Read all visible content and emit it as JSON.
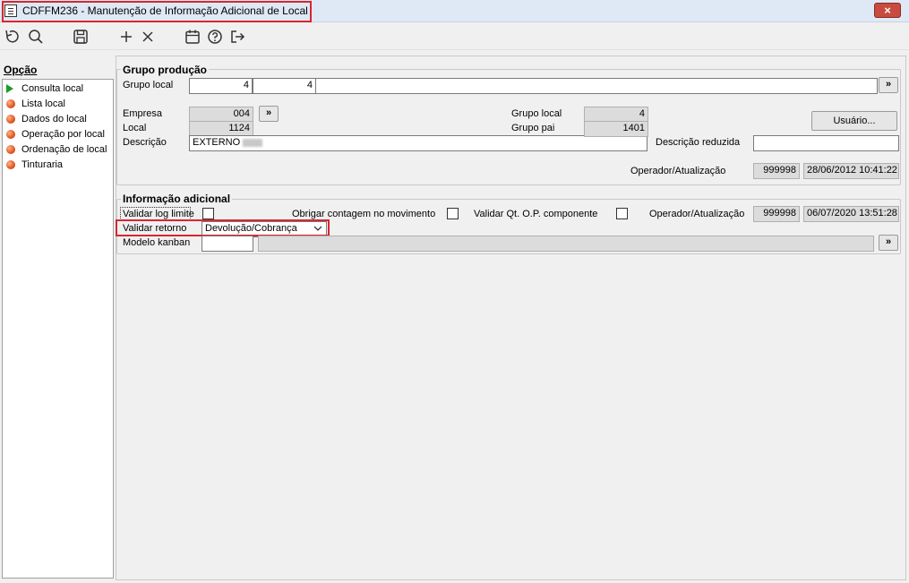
{
  "window": {
    "title": "CDFFM236 - Manutenção de Informação Adicional de Local",
    "close_glyph": "×"
  },
  "toolbar": {
    "icons": [
      "refresh-icon",
      "search-icon",
      "save-icon",
      "add-icon",
      "cancel-icon",
      "calendar-icon",
      "help-icon",
      "exit-icon"
    ]
  },
  "sidebar": {
    "heading": "Opção",
    "items": [
      {
        "label": "Consulta local",
        "icon": "play-icon"
      },
      {
        "label": "Lista local",
        "icon": "bullet-icon"
      },
      {
        "label": "Dados do local",
        "icon": "bullet-icon"
      },
      {
        "label": "Operação por local",
        "icon": "bullet-icon"
      },
      {
        "label": "Ordenação de local",
        "icon": "bullet-icon"
      },
      {
        "label": "Tinturaria",
        "icon": "bullet-icon"
      }
    ]
  },
  "grupo_producao": {
    "title": "Grupo produção",
    "grupo_local_label": "Grupo local",
    "grupo_local_value1": "4",
    "grupo_local_value2": "4",
    "lookup_glyph": "»",
    "empresa_label": "Empresa",
    "empresa_value": "004",
    "local_label": "Local",
    "local_value": "1124",
    "descricao_label": "Descrição",
    "descricao_value": "EXTERNO",
    "grupo_local2_label": "Grupo local",
    "grupo_local2_value": "4",
    "grupo_pai_label": "Grupo pai",
    "grupo_pai_value": "1401",
    "usuario_button": "Usuário...",
    "descricao_reduzida_label": "Descrição reduzida",
    "descricao_reduzida_value": "",
    "operador_label": "Operador/Atualização",
    "operador_value": "999998",
    "atualizacao_value": "28/06/2012 10:41:22"
  },
  "info_adicional": {
    "title": "Informação adicional",
    "validar_log_label": "Validar log limite",
    "obrigar_contagem_label": "Obrigar contagem no movimento",
    "validar_qt_label": "Validar Qt. O.P. componente",
    "operador_label": "Operador/Atualização",
    "operador_value": "999998",
    "atualizacao_value": "06/07/2020 13:51:28",
    "validar_retorno_label": "Validar retorno",
    "validar_retorno_value": "Devolução/Cobrança",
    "modelo_kanban_label": "Modelo kanban",
    "modelo_kanban_value": "",
    "lookup_glyph": "»"
  },
  "colors": {
    "highlight": "#d9262f",
    "readonly_bg": "#dcdcdc",
    "titlebar_bg": "#dfe9f5"
  }
}
